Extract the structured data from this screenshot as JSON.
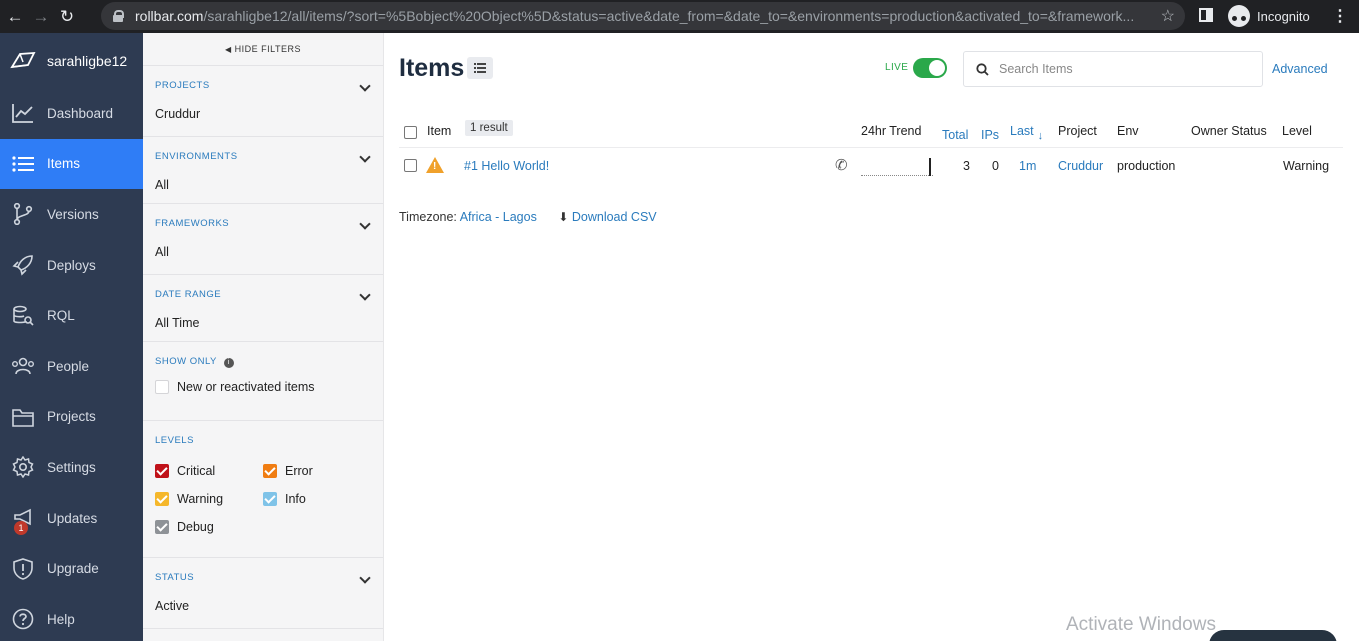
{
  "browser": {
    "url_host": "rollbar.com",
    "url_path": "/sarahligbe12/all/items/?sort=%5Bobject%20Object%5D&status=active&date_from=&date_to=&environments=production&activated_to=&framework...",
    "incognito_label": "Incognito"
  },
  "sidebar": {
    "account": "sarahligbe12",
    "items": [
      {
        "label": "Dashboard",
        "icon": "chart-line-icon"
      },
      {
        "label": "Items",
        "icon": "list-icon"
      },
      {
        "label": "Versions",
        "icon": "branch-icon"
      },
      {
        "label": "Deploys",
        "icon": "rocket-icon"
      },
      {
        "label": "RQL",
        "icon": "database-search-icon"
      },
      {
        "label": "People",
        "icon": "people-icon"
      },
      {
        "label": "Projects",
        "icon": "folder-icon"
      },
      {
        "label": "Settings",
        "icon": "gear-icon"
      },
      {
        "label": "Updates",
        "icon": "megaphone-icon",
        "badge": "1"
      },
      {
        "label": "Upgrade",
        "icon": "shield-icon"
      },
      {
        "label": "Help",
        "icon": "help-icon"
      }
    ],
    "active_index": 1
  },
  "filters": {
    "hide_label": "HIDE FILTERS",
    "projects": {
      "title": "PROJECTS",
      "value": "Cruddur"
    },
    "environments": {
      "title": "ENVIRONMENTS",
      "value": "All"
    },
    "frameworks": {
      "title": "FRAMEWORKS",
      "value": "All"
    },
    "date_range": {
      "title": "DATE RANGE",
      "value": "All Time"
    },
    "show_only": {
      "title": "SHOW ONLY",
      "option": "New or reactivated items"
    },
    "levels": {
      "title": "LEVELS",
      "items": [
        {
          "label": "Critical",
          "color": "#c0121a",
          "checked": true
        },
        {
          "label": "Error",
          "color": "#f07d12",
          "checked": true
        },
        {
          "label": "Warning",
          "color": "#f5b72b",
          "checked": true
        },
        {
          "label": "Info",
          "color": "#7fc3e8",
          "checked": true
        },
        {
          "label": "Debug",
          "color": "#8e9297",
          "checked": true
        }
      ]
    },
    "status": {
      "title": "STATUS",
      "value": "Active"
    }
  },
  "main": {
    "title": "Items",
    "live_label": "LIVE",
    "live_on": true,
    "search_placeholder": "Search Items",
    "advanced_label": "Advanced",
    "table": {
      "headers": {
        "item": "Item",
        "result_count": "1 result",
        "trend": "24hr Trend",
        "total": "Total",
        "ips": "IPs",
        "last": "Last",
        "project": "Project",
        "env": "Env",
        "owner_status": "Owner Status",
        "level": "Level"
      },
      "rows": [
        {
          "title": "#1 Hello World!",
          "total": "3",
          "ips": "0",
          "last": "1m",
          "project": "Cruddur",
          "env": "production",
          "level": "Warning"
        }
      ]
    },
    "timezone_label": "Timezone:",
    "timezone_value": "Africa - Lagos",
    "download_label": "Download CSV"
  },
  "os_watermark": "Activate Windows"
}
